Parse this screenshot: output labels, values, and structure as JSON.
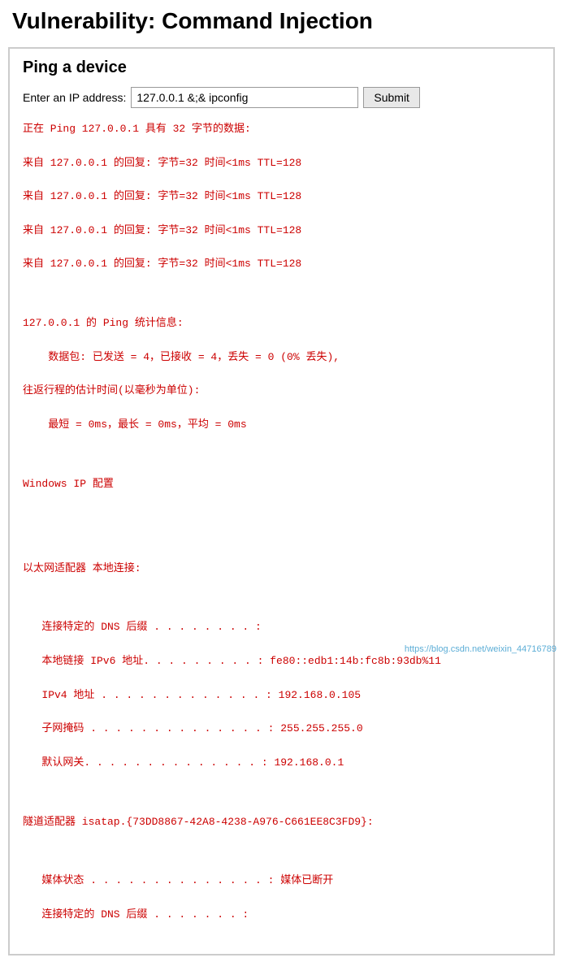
{
  "page": {
    "title": "Vulnerability: Command Injection"
  },
  "section": {
    "title": "Ping a device"
  },
  "form": {
    "label": "Enter an IP address:",
    "input_value": "127.0.0.1 &;& ipconfig",
    "submit_label": "Submit"
  },
  "output": {
    "lines": [
      "正在 Ping 127.0.0.1 具有 32 字节的数据:",
      "来自 127.0.0.1 的回复: 字节=32 时间<1ms TTL=128",
      "来自 127.0.0.1 的回复: 字节=32 时间<1ms TTL=128",
      "来自 127.0.0.1 的回复: 字节=32 时间<1ms TTL=128",
      "来自 127.0.0.1 的回复: 字节=32 时间<1ms TTL=128",
      "",
      "127.0.0.1 的 Ping 统计信息:",
      "    数据包: 已发送 = 4，已接收 = 4，丢失 = 0 (0% 丢失),",
      "往返行程的估计时间(以毫秒为单位):",
      "    最短 = 0ms，最长 = 0ms，平均 = 0ms",
      "",
      "Windows IP 配置",
      "",
      "",
      "以太网适配器 本地连接:",
      "",
      "   连接特定的 DNS 后缀 . . . . . . . . :",
      "   本地链接 IPv6 地址. . . . . . . . . : fe80::edb1:14b:fc8b:93db%11",
      "   IPv4 地址 . . . . . . . . . . . . . : 192.168.0.105",
      "   子网掩码 . . . . . . . . . . . . . . : 255.255.255.0",
      "   默认网关. . . . . . . . . . . . . . : 192.168.0.1",
      "",
      "隧道适配器 isatap.{73DD8867-42A8-4238-A976-C661EE8C3FD9}:",
      "",
      "   媒体状态 . . . . . . . . . . . . . . : 媒体已断开",
      "   连接特定的 DNS 后缀 . . . . . . . :"
    ]
  },
  "watermark": {
    "text": "https://blog.csdn.net/weixin_44716789"
  }
}
